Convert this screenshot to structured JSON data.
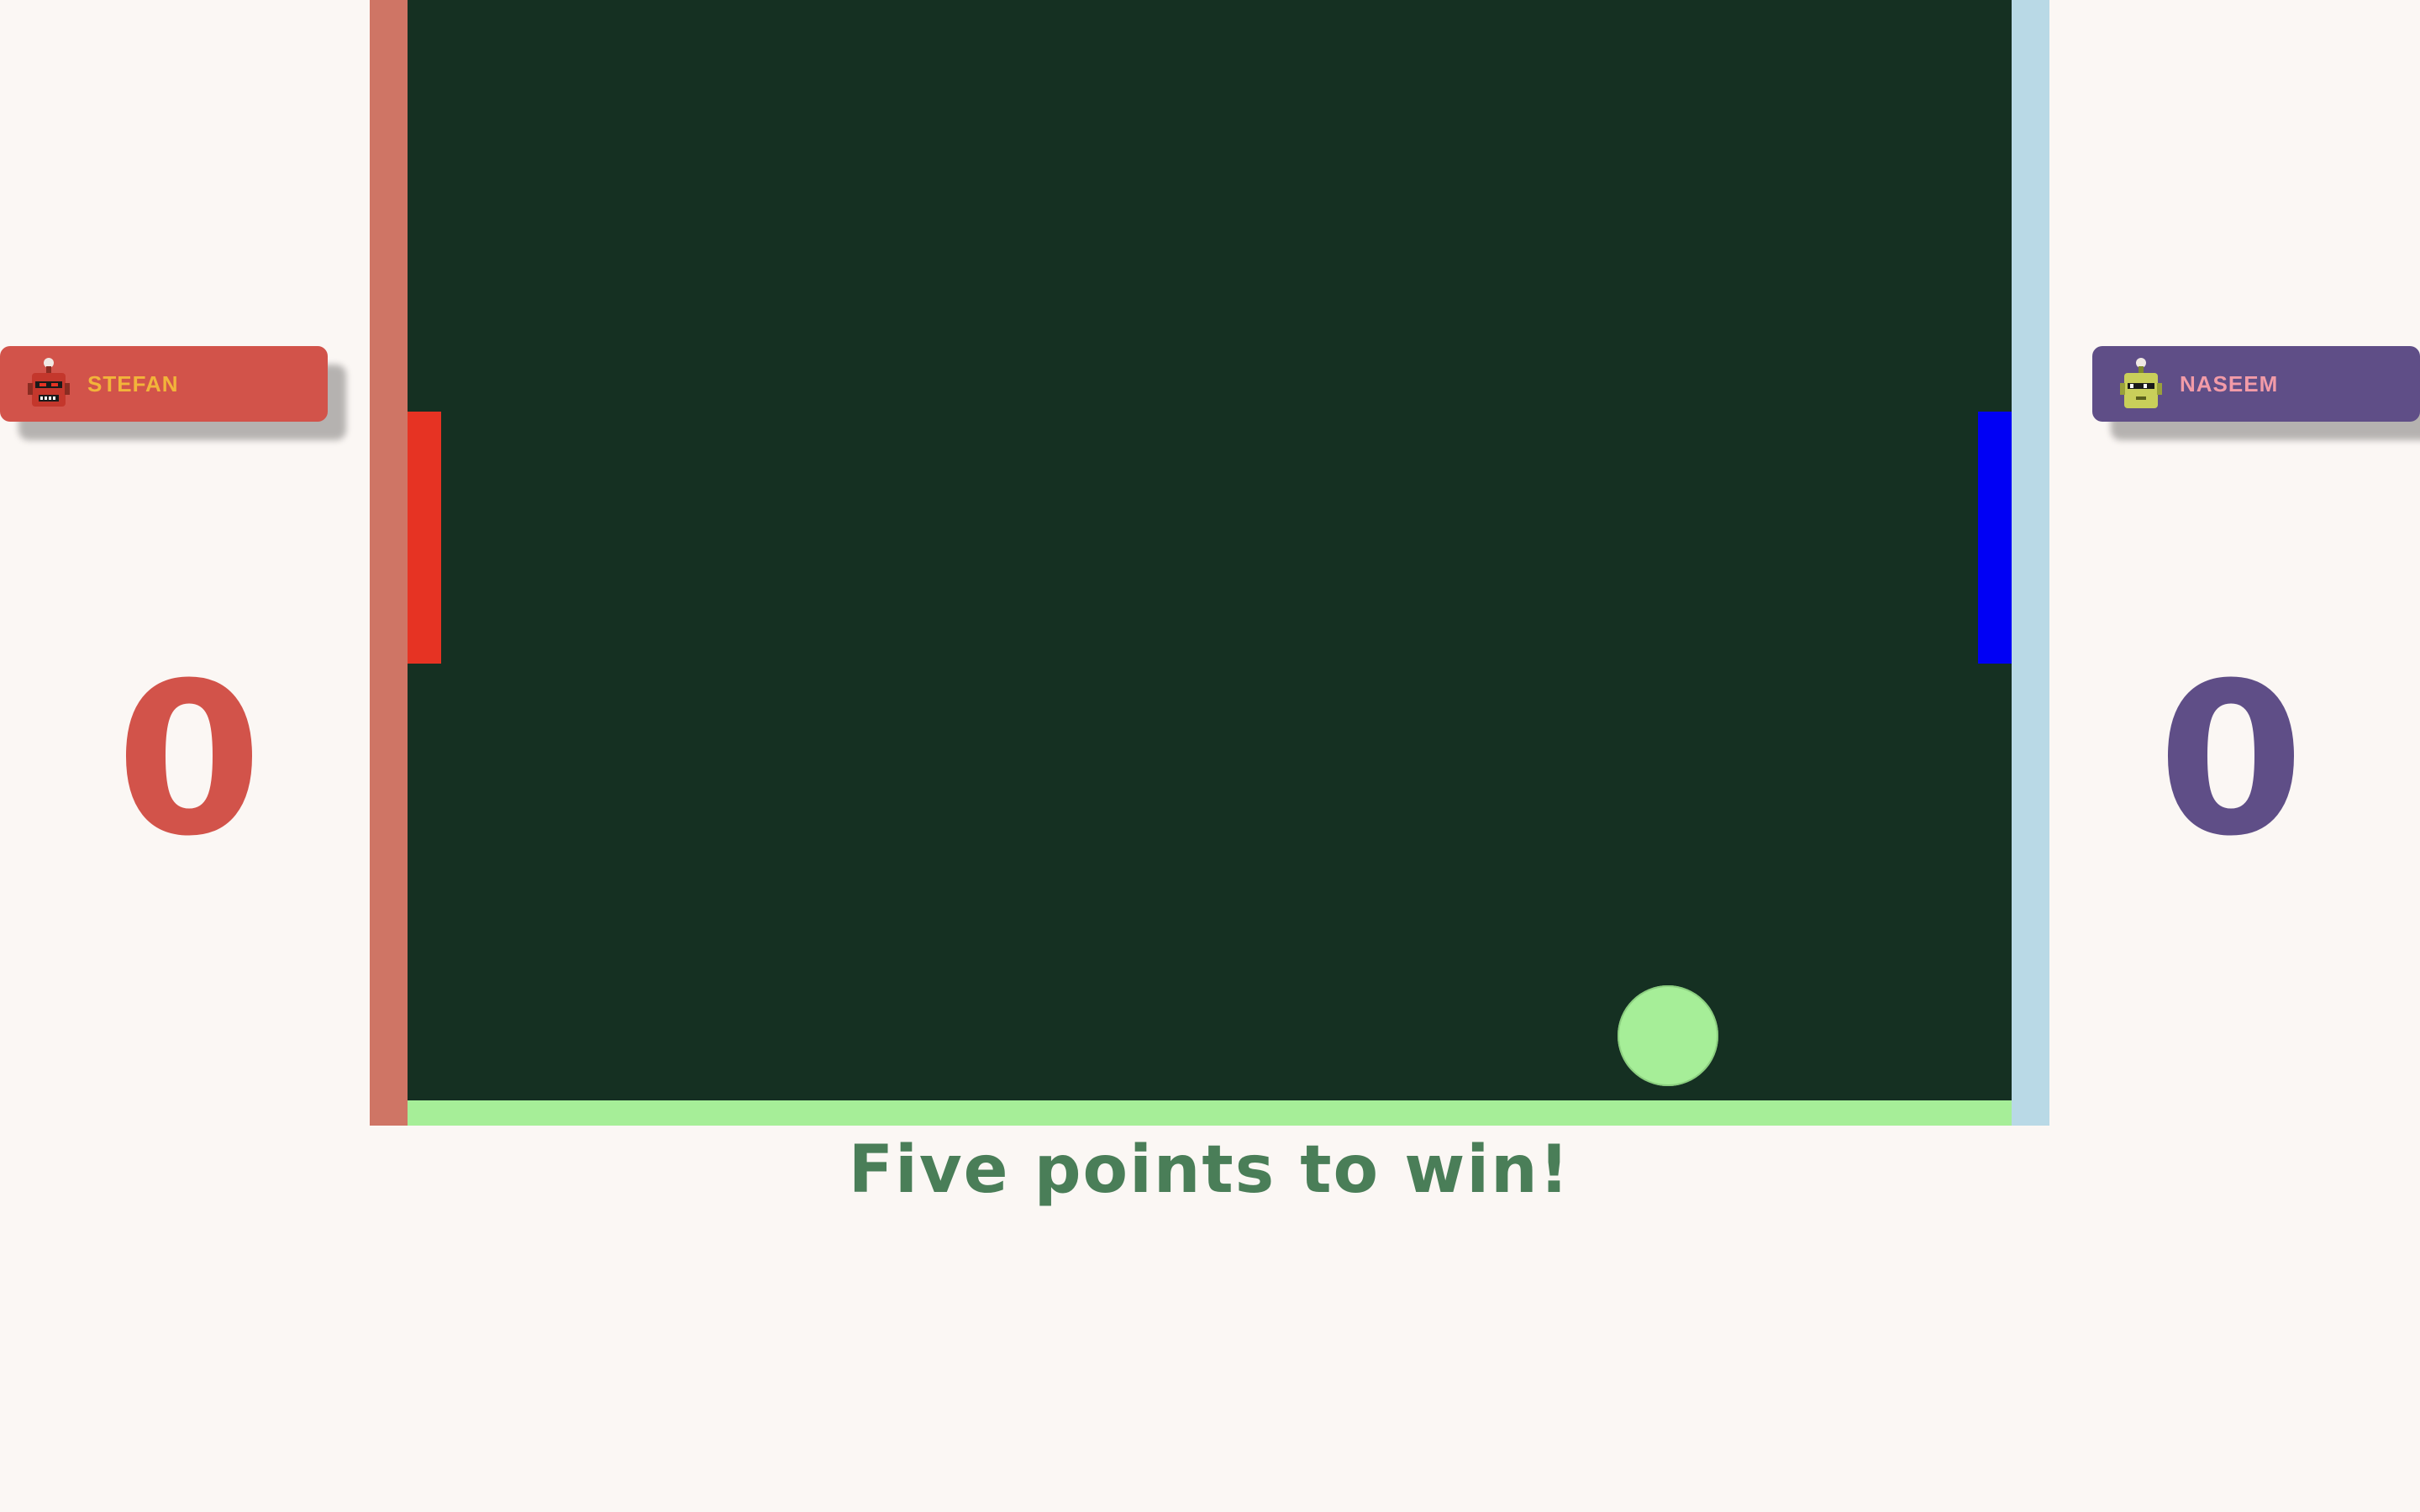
{
  "players": {
    "left": {
      "name": "STEFAN",
      "score": "0",
      "avatar_icon": "red-robot-icon",
      "color": "#d2534a"
    },
    "right": {
      "name": "NASEEM",
      "score": "0",
      "avatar_icon": "yellow-robot-icon",
      "color": "#5f4e87"
    }
  },
  "game": {
    "court_color": "#153022",
    "ball_color": "#a6ee98",
    "left_paddle_color": "#e63323",
    "right_paddle_color": "#0000f5",
    "message": "Five points to win!"
  }
}
